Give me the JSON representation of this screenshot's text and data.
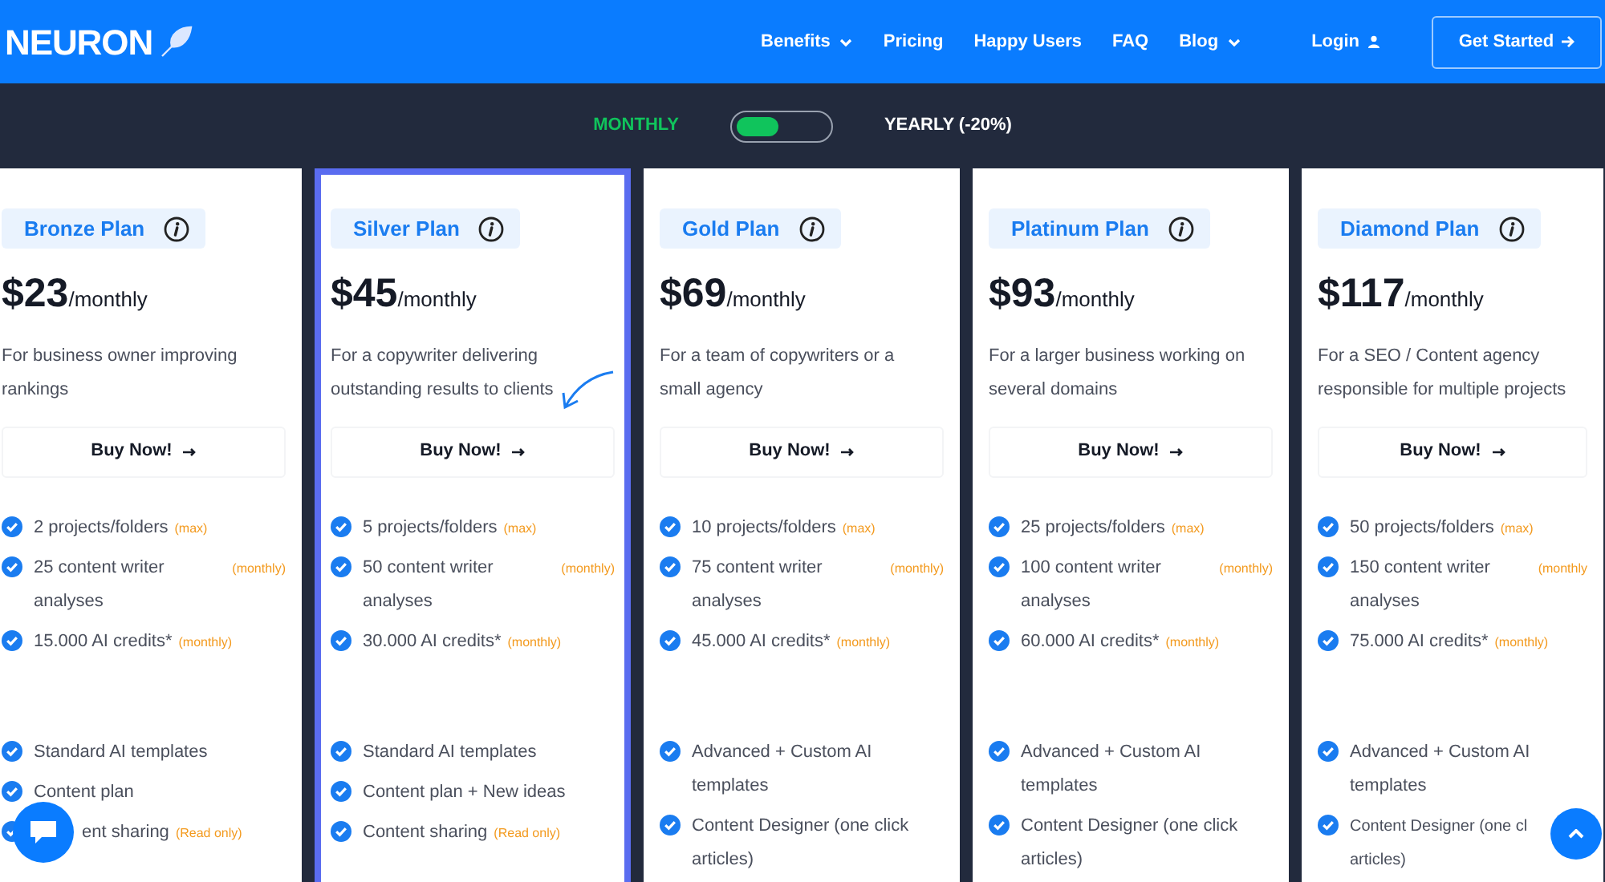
{
  "nav": {
    "logo": "NEURON",
    "links": [
      {
        "label": "Benefits",
        "dropdown": true
      },
      {
        "label": "Pricing",
        "dropdown": false
      },
      {
        "label": "Happy Users",
        "dropdown": false
      },
      {
        "label": "FAQ",
        "dropdown": false
      },
      {
        "label": "Blog",
        "dropdown": true
      }
    ],
    "login": "Login",
    "cta": "Get Started"
  },
  "billing": {
    "monthly": "MONTHLY",
    "yearly": "YEARLY (-20%)",
    "yearly_on": false
  },
  "plans": [
    {
      "name": "Bronze Plan",
      "price": "$23",
      "period": "/monthly",
      "description": "For business owner improving rankings",
      "button": "Buy Now!",
      "highlighted": false,
      "limits": [
        {
          "text": "2 projects/folders",
          "note": "(max)",
          "kind": "inline"
        },
        {
          "text": "25 content writer analyses",
          "note": "(monthly)",
          "kind": "aside"
        },
        {
          "text": "15.000 AI credits*",
          "note": "(monthly)",
          "kind": "inline"
        }
      ],
      "features": [
        {
          "text": "Standard AI templates",
          "kind": "inline"
        },
        {
          "text": "Content plan",
          "kind": "inline"
        },
        {
          "text": "ent sharing",
          "note": "(Read only)",
          "kind": "covered"
        }
      ]
    },
    {
      "name": "Silver Plan",
      "price": "$45",
      "period": "/monthly",
      "description": "For a copywriter delivering outstanding results to clients",
      "button": "Buy Now!",
      "highlighted": true,
      "limits": [
        {
          "text": "5 projects/folders",
          "note": "(max)",
          "kind": "inline"
        },
        {
          "text": "50 content writer analyses",
          "note": "(monthly)",
          "kind": "aside"
        },
        {
          "text": "30.000 AI credits*",
          "note": "(monthly)",
          "kind": "inline"
        }
      ],
      "features": [
        {
          "text": "Standard AI templates",
          "kind": "inline"
        },
        {
          "text": "Content plan + New ideas",
          "kind": "inline"
        },
        {
          "text": "Content sharing",
          "note": "(Read only)",
          "kind": "inline"
        }
      ]
    },
    {
      "name": "Gold Plan",
      "price": "$69",
      "period": "/monthly",
      "description": "For a team of copywriters or a small agency",
      "button": "Buy Now!",
      "highlighted": false,
      "limits": [
        {
          "text": "10 projects/folders",
          "note": "(max)",
          "kind": "inline"
        },
        {
          "text": "75 content writer analyses",
          "note": "(monthly)",
          "kind": "aside"
        },
        {
          "text": "45.000 AI credits*",
          "note": "(monthly)",
          "kind": "inline"
        }
      ],
      "features": [
        {
          "text": "Advanced + Custom AI templates",
          "kind": "inline"
        },
        {
          "text": "Content Designer (one click articles)",
          "kind": "inline"
        }
      ]
    },
    {
      "name": "Platinum Plan",
      "price": "$93",
      "period": "/monthly",
      "description": "For a larger business working on several domains",
      "button": "Buy Now!",
      "highlighted": false,
      "limits": [
        {
          "text": "25 projects/folders",
          "note": "(max)",
          "kind": "inline"
        },
        {
          "text": "100 content writer analyses",
          "note": "(monthly)",
          "kind": "aside"
        },
        {
          "text": "60.000 AI credits*",
          "note": "(monthly)",
          "kind": "inline"
        }
      ],
      "features": [
        {
          "text": "Advanced + Custom AI templates",
          "kind": "inline"
        },
        {
          "text": "Content Designer (one click articles)",
          "kind": "inline"
        }
      ]
    },
    {
      "name": "Diamond Plan",
      "price": "$117",
      "period": "/monthly",
      "description": "For a SEO / Content agency responsible for multiple projects",
      "button": "Buy Now!",
      "highlighted": false,
      "limits": [
        {
          "text": "50 projects/folders",
          "note": "(max)",
          "kind": "inline"
        },
        {
          "text": "150 content writer analyses",
          "note": "(monthly",
          "kind": "aside"
        },
        {
          "text": "75.000 AI credits*",
          "note": "(monthly)",
          "kind": "inline"
        }
      ],
      "features": [
        {
          "text": "Advanced + Custom AI templates",
          "kind": "inline"
        },
        {
          "text": "Content Designer (one cl articles)",
          "kind": "clipped"
        }
      ]
    }
  ]
}
